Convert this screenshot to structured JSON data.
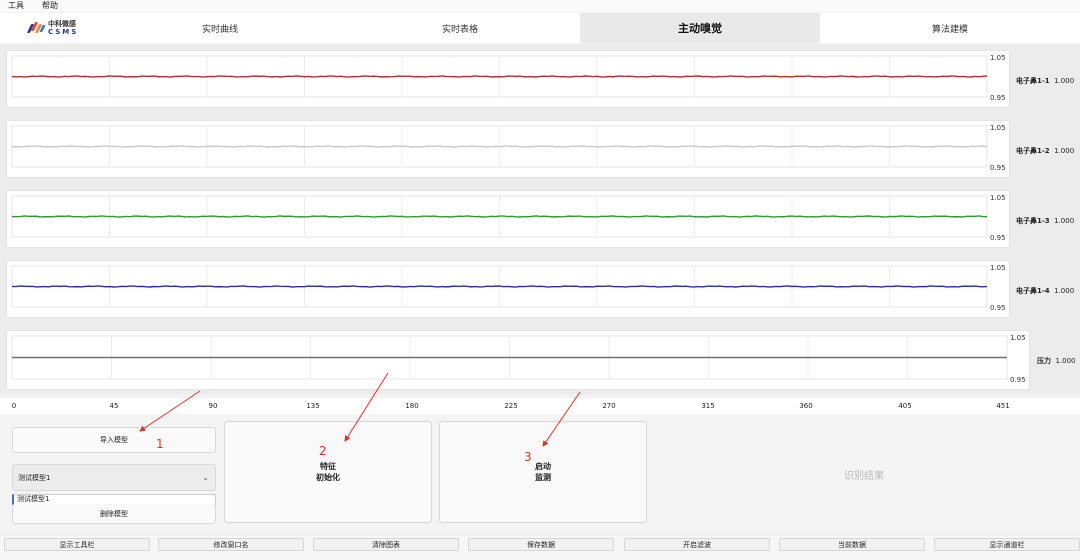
{
  "menu": [
    "工具",
    "帮助"
  ],
  "logo": {
    "cn": "中科微感",
    "en": "CSMS"
  },
  "tabs": [
    {
      "label": "实时曲线",
      "active": false
    },
    {
      "label": "实时表格",
      "active": false
    },
    {
      "label": "主动嗅觉",
      "active": true
    },
    {
      "label": "算法建模",
      "active": false
    }
  ],
  "channels": [
    {
      "name": "电子鼻1-1",
      "value": "1.000",
      "ymax": "1.05",
      "ymin": "0.95",
      "color": "#b03030"
    },
    {
      "name": "电子鼻1-2",
      "value": "1.000",
      "ymax": "1.05",
      "ymin": "0.95",
      "color": "#c8c8c8"
    },
    {
      "name": "电子鼻1-3",
      "value": "1.000",
      "ymax": "1.05",
      "ymin": "0.95",
      "color": "#2e9a2e"
    },
    {
      "name": "电子鼻1-4",
      "value": "1.000",
      "ymax": "1.05",
      "ymin": "0.95",
      "color": "#2a2fa0"
    },
    {
      "name": "压力",
      "value": "1.000",
      "ymax": "1.05",
      "ymin": "0.95",
      "color": "#707070"
    }
  ],
  "x_ticks": [
    "0",
    "45",
    "90",
    "135",
    "180",
    "225",
    "270",
    "315",
    "360",
    "405",
    "451"
  ],
  "controls": {
    "import_model": "导入模型",
    "model_select": "测试模型1",
    "model_list_item": "测试模型1",
    "delete_model": "删除模型",
    "feature_init": [
      "特征",
      "初始化"
    ],
    "start_monitor": [
      "启动",
      "监测"
    ],
    "result": "识别结果"
  },
  "annotations": [
    "1",
    "2",
    "3"
  ],
  "bottom_buttons": [
    "显示工具栏",
    "修改窗口名",
    "清除图表",
    "保存数据",
    "开启滤波",
    "当前数据",
    "显示通道栏"
  ],
  "annotation_color": "#e0322b"
}
